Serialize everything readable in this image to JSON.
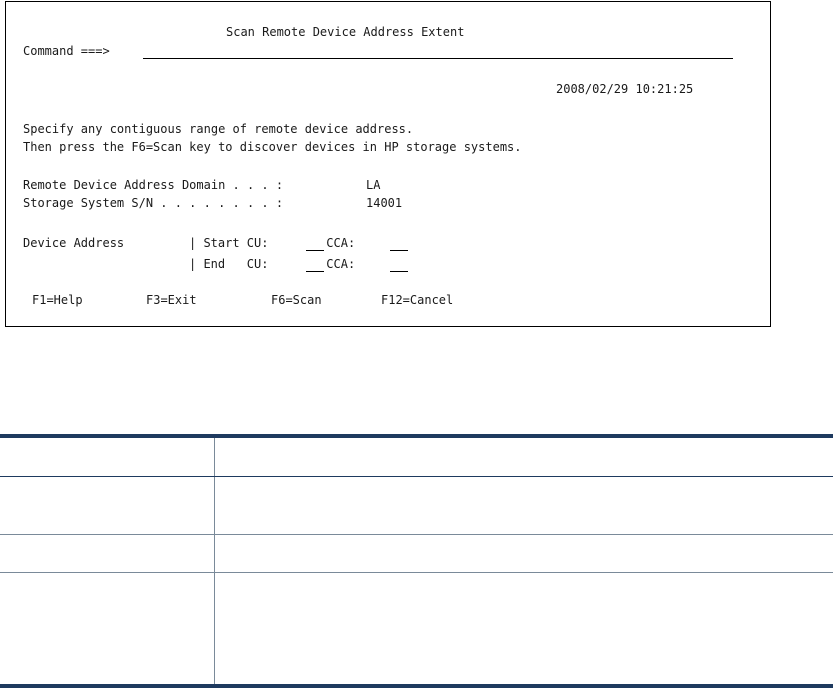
{
  "screen": {
    "title": "Scan Remote Device Address Extent",
    "command_label": "Command ===>",
    "command_value": "",
    "timestamp": "2008/02/29 10:21:25",
    "instructions": [
      "Specify any contiguous range of remote device address.",
      "Then press the F6=Scan key to discover devices in HP storage systems."
    ],
    "domain_label": "Remote Device Address Domain . . . :",
    "domain_value": "LA",
    "serial_label": "Storage System S/N . . . . . . . . :",
    "serial_value": "14001",
    "device_address_label": "Device Address",
    "start_row_label": "| Start CU:        CCA:",
    "end_row_label": "| End   CU:        CCA:",
    "start_cu": "",
    "start_cca": "",
    "end_cu": "",
    "end_cca": "",
    "function_keys": [
      "F1=Help",
      "F3=Exit",
      "F6=Scan",
      "F12=Cancel"
    ]
  },
  "table": {
    "rows": [
      {
        "field": "",
        "description": ""
      },
      {
        "field": "",
        "description": ""
      },
      {
        "field": "",
        "description": ""
      },
      {
        "field": "",
        "description": ""
      }
    ]
  },
  "colors": {
    "table_rule": "#1e3a5f",
    "table_grid": "#7a8a99",
    "screen_border": "#000000"
  }
}
